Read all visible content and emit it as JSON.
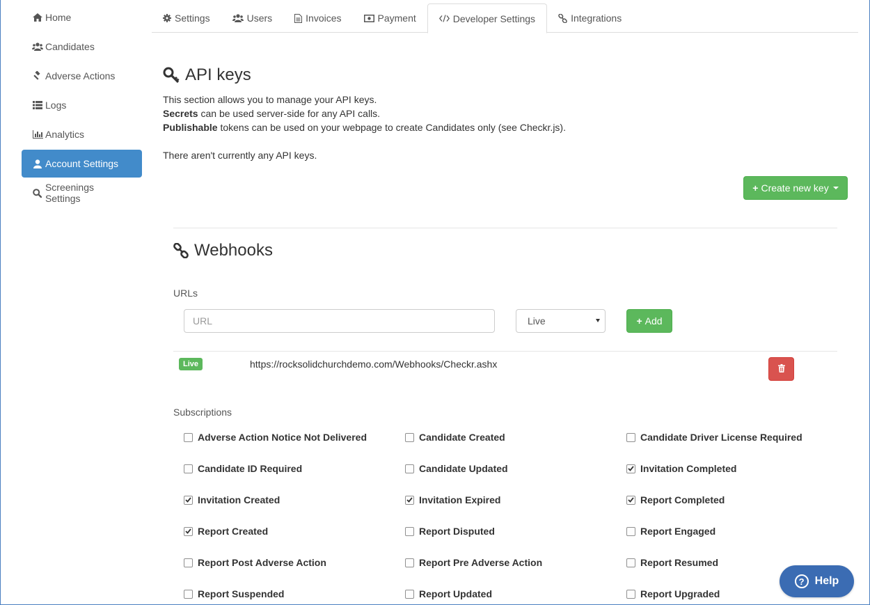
{
  "sidebar": {
    "items": [
      {
        "label": "Home",
        "icon": "home-icon"
      },
      {
        "label": "Candidates",
        "icon": "users-icon"
      },
      {
        "label": "Adverse Actions",
        "icon": "gavel-icon"
      },
      {
        "label": "Logs",
        "icon": "list-icon"
      },
      {
        "label": "Analytics",
        "icon": "bar-chart-icon"
      },
      {
        "label": "Account Settings",
        "icon": "user-icon",
        "active": true
      },
      {
        "label": "Screenings Settings",
        "icon": "search-icon"
      }
    ]
  },
  "tabs": [
    {
      "label": "Settings",
      "icon": "cog-icon"
    },
    {
      "label": "Users",
      "icon": "users-icon"
    },
    {
      "label": "Invoices",
      "icon": "document-icon"
    },
    {
      "label": "Payment",
      "icon": "money-icon"
    },
    {
      "label": "Developer Settings",
      "icon": "code-icon",
      "active": true
    },
    {
      "label": "Integrations",
      "icon": "link-icon"
    }
  ],
  "api_keys": {
    "title": "API keys",
    "intro": "This section allows you to manage your API keys.",
    "secrets_bold": "Secrets",
    "secrets_rest": " can be used server-side for any API calls.",
    "publishable_bold": "Publishable",
    "publishable_rest": " tokens can be used on your webpage to create Candidates only (see Checkr.js).",
    "empty_text": "There aren't currently any API keys.",
    "create_button": "Create new key"
  },
  "webhooks": {
    "title": "Webhooks",
    "urls_label": "URLs",
    "url_placeholder": "URL",
    "env_selected": "Live",
    "add_button": "Add",
    "rows": [
      {
        "env": "Live",
        "url": "https://rocksolidchurchdemo.com/Webhooks/Checkr.ashx"
      }
    ],
    "subscriptions_label": "Subscriptions",
    "subscriptions": [
      {
        "label": "Adverse Action Notice Not Delivered",
        "checked": false
      },
      {
        "label": "Candidate Created",
        "checked": false
      },
      {
        "label": "Candidate Driver License Required",
        "checked": false
      },
      {
        "label": "Candidate ID Required",
        "checked": false
      },
      {
        "label": "Candidate Updated",
        "checked": false
      },
      {
        "label": "Invitation Completed",
        "checked": true
      },
      {
        "label": "Invitation Created",
        "checked": true
      },
      {
        "label": "Invitation Expired",
        "checked": true
      },
      {
        "label": "Report Completed",
        "checked": true
      },
      {
        "label": "Report Created",
        "checked": true
      },
      {
        "label": "Report Disputed",
        "checked": false
      },
      {
        "label": "Report Engaged",
        "checked": false
      },
      {
        "label": "Report Post Adverse Action",
        "checked": false
      },
      {
        "label": "Report Pre Adverse Action",
        "checked": false
      },
      {
        "label": "Report Resumed",
        "checked": false
      },
      {
        "label": "Report Suspended",
        "checked": false
      },
      {
        "label": "Report Updated",
        "checked": false
      },
      {
        "label": "Report Upgraded",
        "checked": false
      }
    ]
  },
  "help_button": "Help",
  "colors": {
    "accent": "#428bca",
    "success": "#5cb85c",
    "danger": "#d9534f",
    "help": "#3b6cb3"
  }
}
